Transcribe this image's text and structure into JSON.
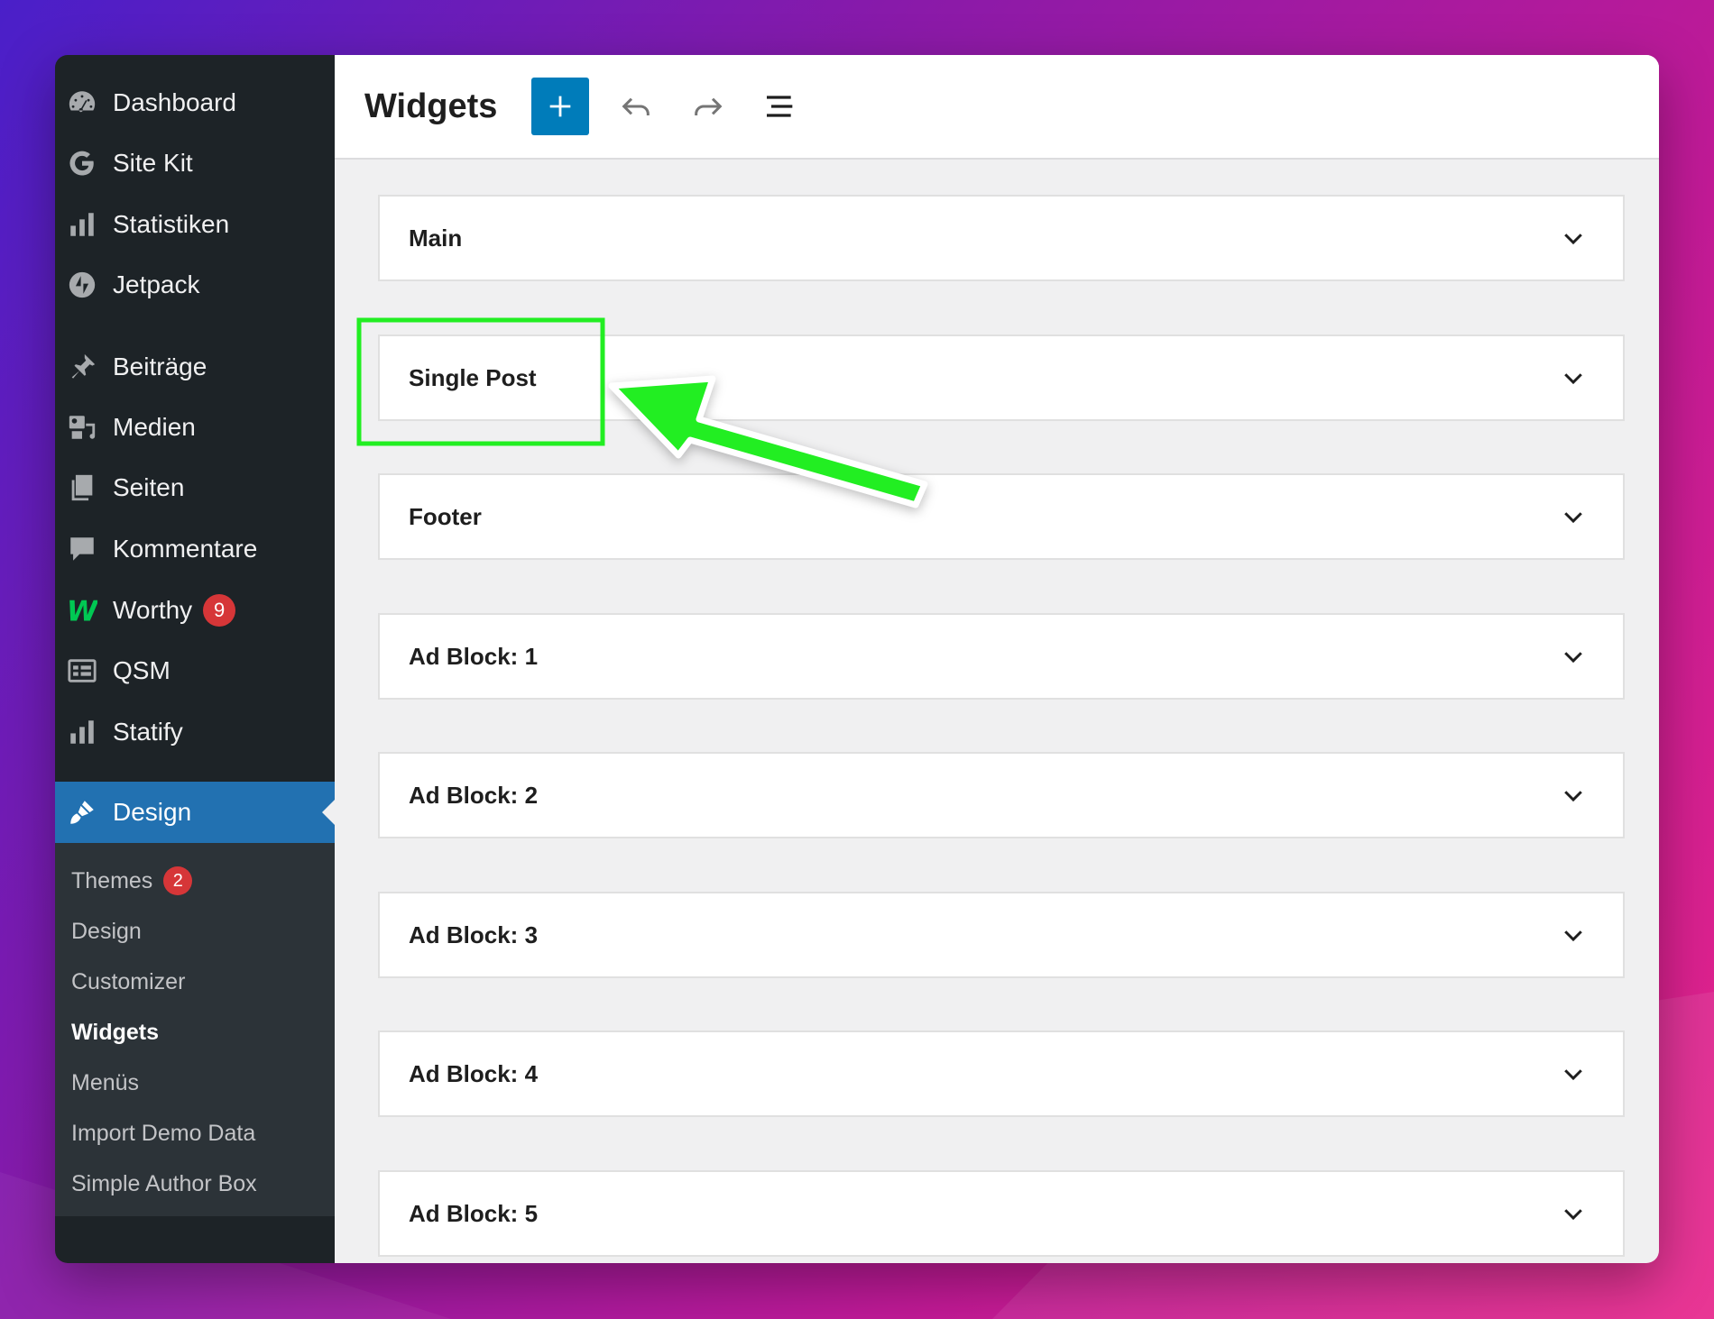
{
  "sidebar": {
    "items": [
      {
        "label": "Dashboard",
        "icon": "dashboard-icon"
      },
      {
        "label": "Site Kit",
        "icon": "google-g-icon"
      },
      {
        "label": "Statistiken",
        "icon": "bar-chart-icon"
      },
      {
        "label": "Jetpack",
        "icon": "jetpack-bolt-icon"
      },
      {
        "label": "Beiträge",
        "icon": "pushpin-icon"
      },
      {
        "label": "Medien",
        "icon": "media-icon"
      },
      {
        "label": "Seiten",
        "icon": "pages-icon"
      },
      {
        "label": "Kommentare",
        "icon": "comment-bubble-icon"
      },
      {
        "label": "Worthy",
        "icon": "worthy-w-icon",
        "badge": "9"
      },
      {
        "label": "QSM",
        "icon": "qsm-form-icon"
      },
      {
        "label": "Statify",
        "icon": "bar-chart-icon"
      },
      {
        "label": "Design",
        "icon": "paintbrush-icon",
        "active": true
      }
    ],
    "submenu": [
      {
        "label": "Themes",
        "badge": "2"
      },
      {
        "label": "Design"
      },
      {
        "label": "Customizer"
      },
      {
        "label": "Widgets",
        "current": true
      },
      {
        "label": "Menüs"
      },
      {
        "label": "Import Demo Data"
      },
      {
        "label": "Simple Author Box"
      }
    ]
  },
  "header": {
    "title": "Widgets",
    "add_icon": "plus-icon",
    "undo_icon": "undo-icon",
    "redo_icon": "redo-icon",
    "list_view_icon": "list-view-icon"
  },
  "widget_areas": [
    {
      "label": "Main"
    },
    {
      "label": "Single Post"
    },
    {
      "label": "Footer"
    },
    {
      "label": "Ad Block: 1"
    },
    {
      "label": "Ad Block: 2"
    },
    {
      "label": "Ad Block: 3"
    },
    {
      "label": "Ad Block: 4"
    },
    {
      "label": "Ad Block: 5"
    }
  ],
  "colors": {
    "sidebar_bg": "#1d2327",
    "submenu_bg": "#2c3338",
    "active_blue": "#2271b1",
    "add_button": "#007cba",
    "badge_red": "#d63638",
    "annotation_green": "#22ee22"
  }
}
